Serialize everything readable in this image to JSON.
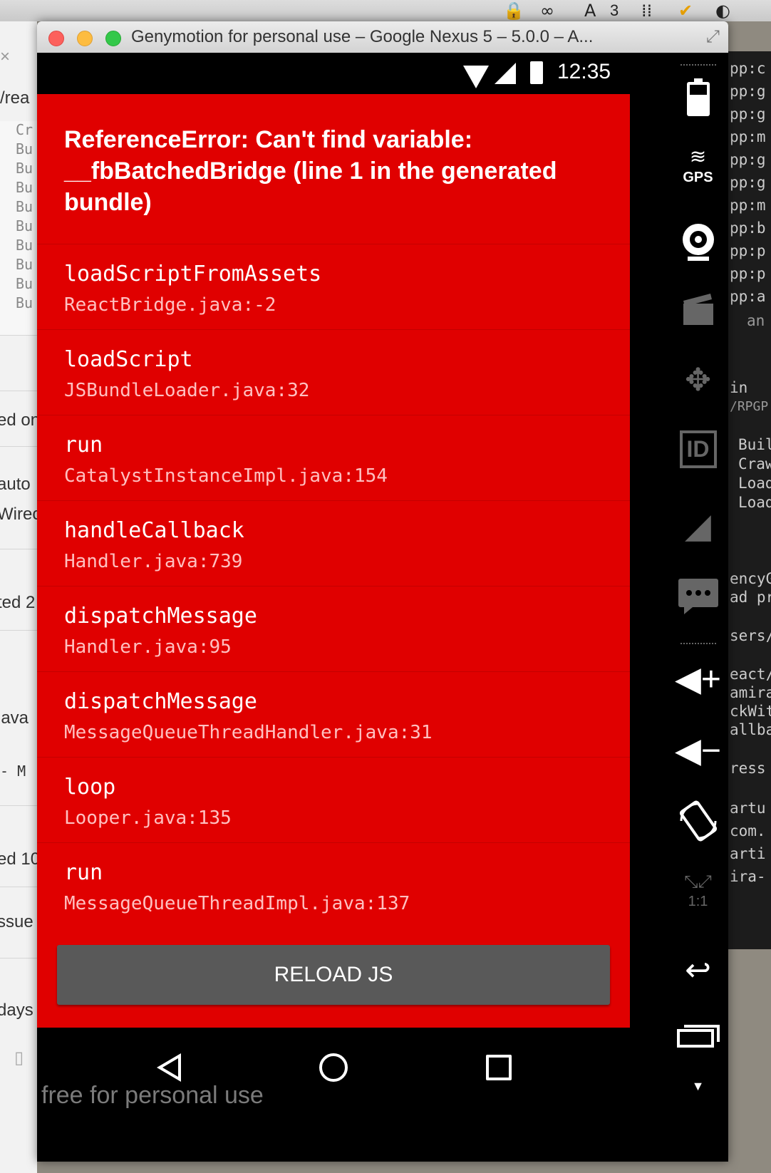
{
  "menubar": {
    "badge_count": "3"
  },
  "window": {
    "title": "Genymotion for personal use – Google Nexus 5 – 5.0.0 – A..."
  },
  "status_bar": {
    "time": "12:35"
  },
  "error": {
    "message": "ReferenceError: Can't find variable: __fbBatchedBridge (line 1 in the generated bundle)",
    "stack": [
      {
        "method": "loadScriptFromAssets",
        "location": "ReactBridge.java:-2"
      },
      {
        "method": "loadScript",
        "location": "JSBundleLoader.java:32"
      },
      {
        "method": "run",
        "location": "CatalystInstanceImpl.java:154"
      },
      {
        "method": "handleCallback",
        "location": "Handler.java:739"
      },
      {
        "method": "dispatchMessage",
        "location": "Handler.java:95"
      },
      {
        "method": "dispatchMessage",
        "location": "MessageQueueThreadHandler.java:31"
      },
      {
        "method": "loop",
        "location": "Looper.java:135"
      },
      {
        "method": "run",
        "location": "MessageQueueThreadImpl.java:137"
      }
    ],
    "reload_label": "RELOAD JS"
  },
  "watermark": "free for personal use",
  "side_panel": {
    "gps_label": "GPS",
    "id_label": "ID",
    "ratio_label": "1:1"
  },
  "background_left": {
    "path_fragment": "/rea",
    "list": [
      "Cr",
      "Bu",
      "Bu",
      "Bu",
      "Bu",
      "Bu",
      "Bu",
      "Bu",
      "Bu",
      "Bu"
    ],
    "rows": [
      "ed on",
      "auto",
      "Wirec",
      "ted 2",
      "java",
      "- M",
      "ed 10",
      "ssue",
      "days"
    ]
  },
  "background_right": {
    "lines": [
      "pp:c",
      "pp:g",
      "pp:g",
      "pp:m",
      "pp:g",
      "pp:g",
      "pp:m",
      "pp:b",
      "pp:p",
      "pp:p",
      "pp:a",
      "an",
      "in",
      "/RPGP",
      "Buil",
      "Craw",
      "Load",
      "Load",
      "encyG",
      "ad pr",
      "sers/",
      "eact/",
      "amira",
      "ckWit",
      "allba",
      "ress",
      "artu",
      "com.",
      "arti",
      "ira-"
    ]
  },
  "icons": {
    "wifi": "wifi-icon",
    "signal": "signal-icon",
    "battery": "battery-icon",
    "back": "back-nav-icon",
    "home": "home-nav-icon",
    "recent": "recent-apps-icon"
  }
}
